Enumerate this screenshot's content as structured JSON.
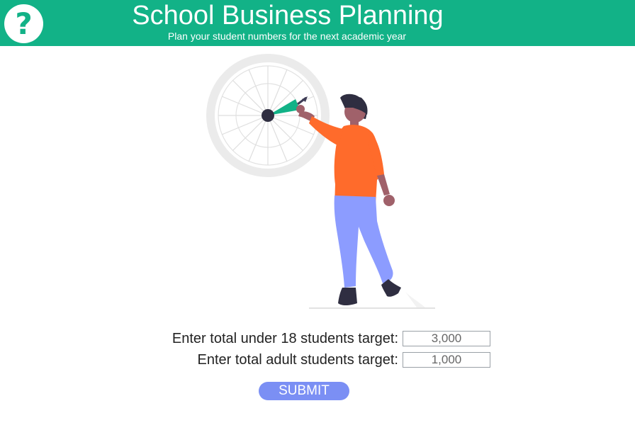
{
  "header": {
    "title": "School Business Planning",
    "subtitle": "Plan your student numbers for the next academic year",
    "help_icon": "?",
    "background_color": "#12b287"
  },
  "illustration": {
    "icon": "person-with-dart-wheel-illustration"
  },
  "form": {
    "under18": {
      "label": "Enter total under 18 students target:",
      "value": "3,000"
    },
    "adult": {
      "label": "Enter total adult students target:",
      "value": "1,000"
    },
    "submit_label": "SUBMIT",
    "submit_color": "#7b8ff4"
  }
}
